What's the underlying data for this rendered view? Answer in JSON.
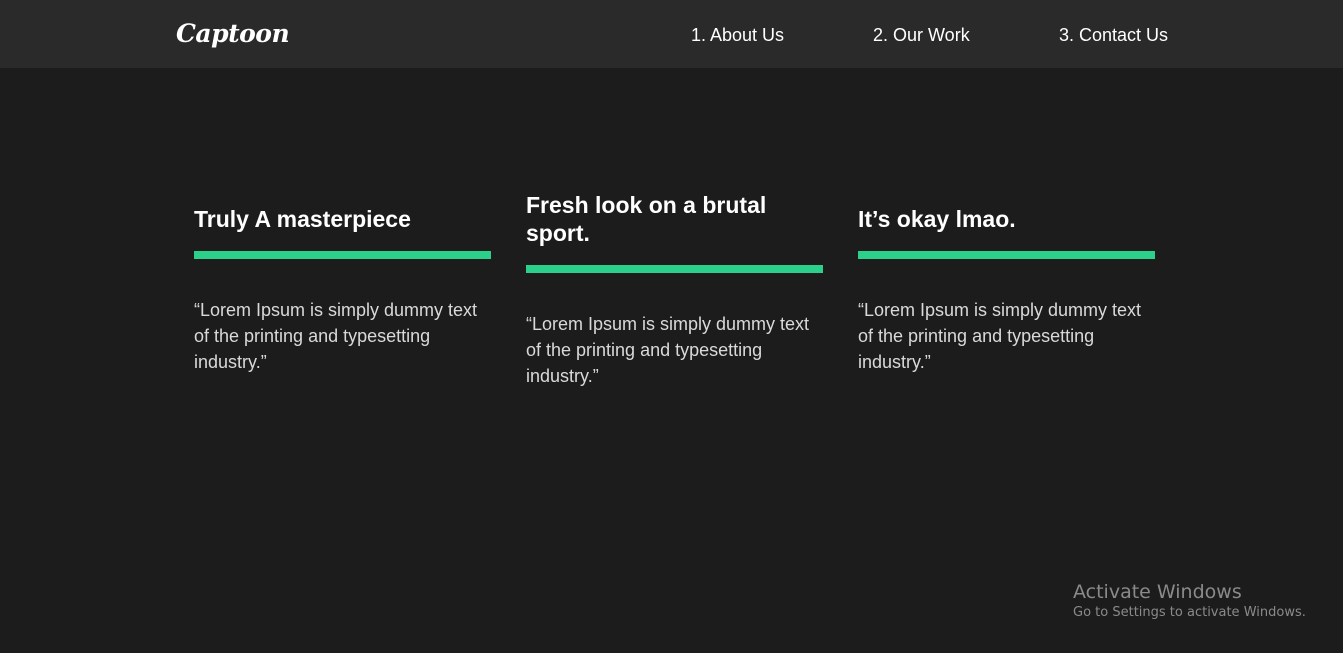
{
  "brand": {
    "logo_text": "Captoon",
    "accent_color": "#2bd08a"
  },
  "nav": {
    "about": "1. About Us",
    "work": "2. Our Work",
    "contact": "3. Contact Us"
  },
  "cards": [
    {
      "title": "Truly A masterpiece",
      "text": "“Lorem Ipsum is simply dummy text of the printing and typesetting industry.”"
    },
    {
      "title": "Fresh look on a brutal sport.",
      "text": "“Lorem Ipsum is simply dummy text of the printing and typesetting industry.”"
    },
    {
      "title": "It’s okay lmao.",
      "text": "“Lorem Ipsum is simply dummy text of the printing and typesetting industry.”"
    }
  ],
  "watermark": {
    "title": "Activate Windows",
    "subtitle": "Go to Settings to activate Windows."
  }
}
